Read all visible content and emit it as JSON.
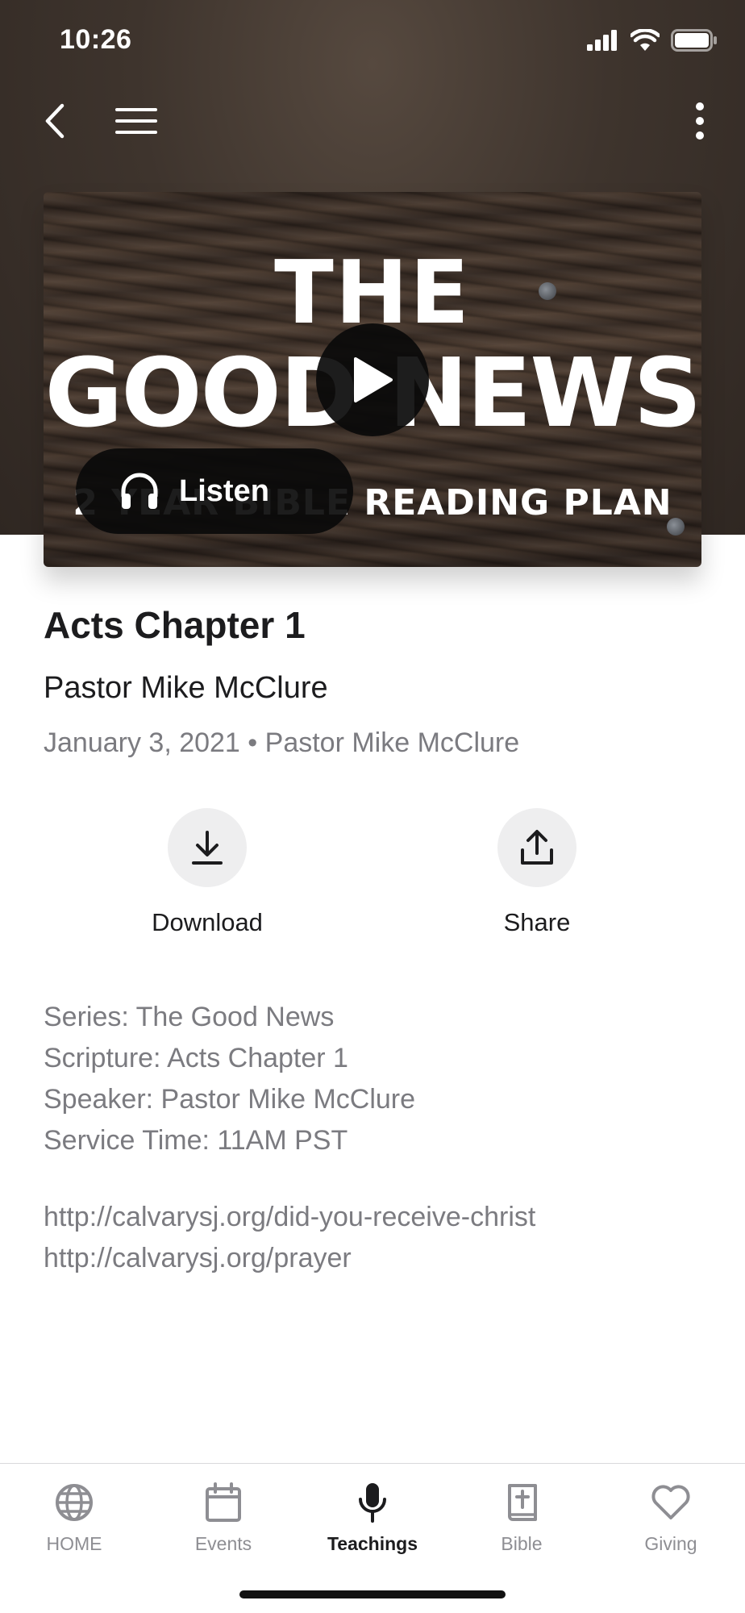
{
  "status_bar": {
    "time": "10:26"
  },
  "media": {
    "artwork_title_line1": "THE",
    "artwork_title_line2": "GOOD NEWS",
    "artwork_title_line3": "2 YEAR BIBLE READING PLAN",
    "listen_label": "Listen"
  },
  "teaching": {
    "title": "Acts Chapter 1",
    "speaker": "Pastor Mike McClure",
    "date_line": "January 3, 2021 • Pastor Mike McClure"
  },
  "actions": {
    "download_label": "Download",
    "share_label": "Share"
  },
  "details": {
    "series": "Series: The Good News",
    "scripture": "Scripture: Acts Chapter 1",
    "speaker": "Speaker: Pastor Mike McClure",
    "service_time": "Service Time: 11AM PST"
  },
  "links": [
    "http://calvarysj.org/did-you-receive-christ",
    "http://calvarysj.org/prayer"
  ],
  "tab_bar": {
    "tabs": [
      {
        "label": "HOME",
        "icon": "globe-icon"
      },
      {
        "label": "Events",
        "icon": "calendar-icon"
      },
      {
        "label": "Teachings",
        "icon": "microphone-icon"
      },
      {
        "label": "Bible",
        "icon": "bible-icon"
      },
      {
        "label": "Giving",
        "icon": "heart-icon"
      }
    ],
    "active": "Teachings"
  },
  "colors": {
    "header_bg": "#3e342d",
    "text_primary": "#1c1c1e",
    "text_secondary": "#7b7b80",
    "tab_inactive": "#8e8e93",
    "action_circle_bg": "#eeeeef"
  }
}
